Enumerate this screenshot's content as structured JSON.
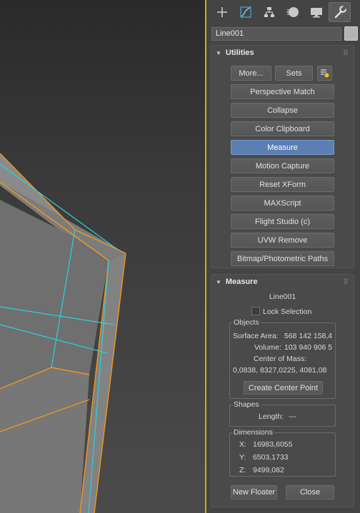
{
  "tabs": [
    {
      "icon": "plus-create-icon"
    },
    {
      "icon": "modify-curve-icon"
    },
    {
      "icon": "hierarchy-icon"
    },
    {
      "icon": "motion-sphere-icon"
    },
    {
      "icon": "display-monitor-icon"
    },
    {
      "icon": "utilities-wrench-icon",
      "active": true
    }
  ],
  "object": {
    "name": "Line001",
    "color": "#b4b4b4"
  },
  "utilities": {
    "title": "Utilities",
    "more_label": "More...",
    "sets_label": "Sets",
    "buttons": [
      {
        "label": "Perspective Match"
      },
      {
        "label": "Collapse"
      },
      {
        "label": "Color Clipboard"
      },
      {
        "label": "Measure",
        "active": true
      },
      {
        "label": "Motion Capture"
      },
      {
        "label": "Reset XForm"
      },
      {
        "label": "MAXScript"
      },
      {
        "label": "Flight Studio (c)"
      },
      {
        "label": "UVW Remove"
      },
      {
        "label": "Bitmap/Photometric Paths"
      }
    ]
  },
  "measure": {
    "title": "Measure",
    "object_name": "Line001",
    "lock_selection_label": "Lock Selection",
    "lock_selection_checked": false,
    "objects": {
      "title": "Objects",
      "surface_area_label": "Surface Area:",
      "surface_area_value": "568 142 158,4",
      "volume_label": "Volume:",
      "volume_value": "103 940 906 5",
      "center_of_mass_label": "Center of Mass:",
      "center_of_mass_value": "0,0838, 8327,0225, 4081,08",
      "create_center_point_label": "Create Center Point"
    },
    "shapes": {
      "title": "Shapes",
      "length_label": "Length:",
      "length_value": "---"
    },
    "dimensions": {
      "title": "Dimensions",
      "x_label": "X:",
      "x_value": "16983,6055",
      "y_label": "Y:",
      "y_value": "6503,1733",
      "z_label": "Z:",
      "z_value": "9499,082"
    },
    "new_floater_label": "New Floater",
    "close_label": "Close"
  },
  "colors": {
    "accent_active": "#5b7fb3",
    "viewport_border": "#c8b400",
    "edge_orange": "#f0961e",
    "edge_cyan": "#28d2dc"
  }
}
